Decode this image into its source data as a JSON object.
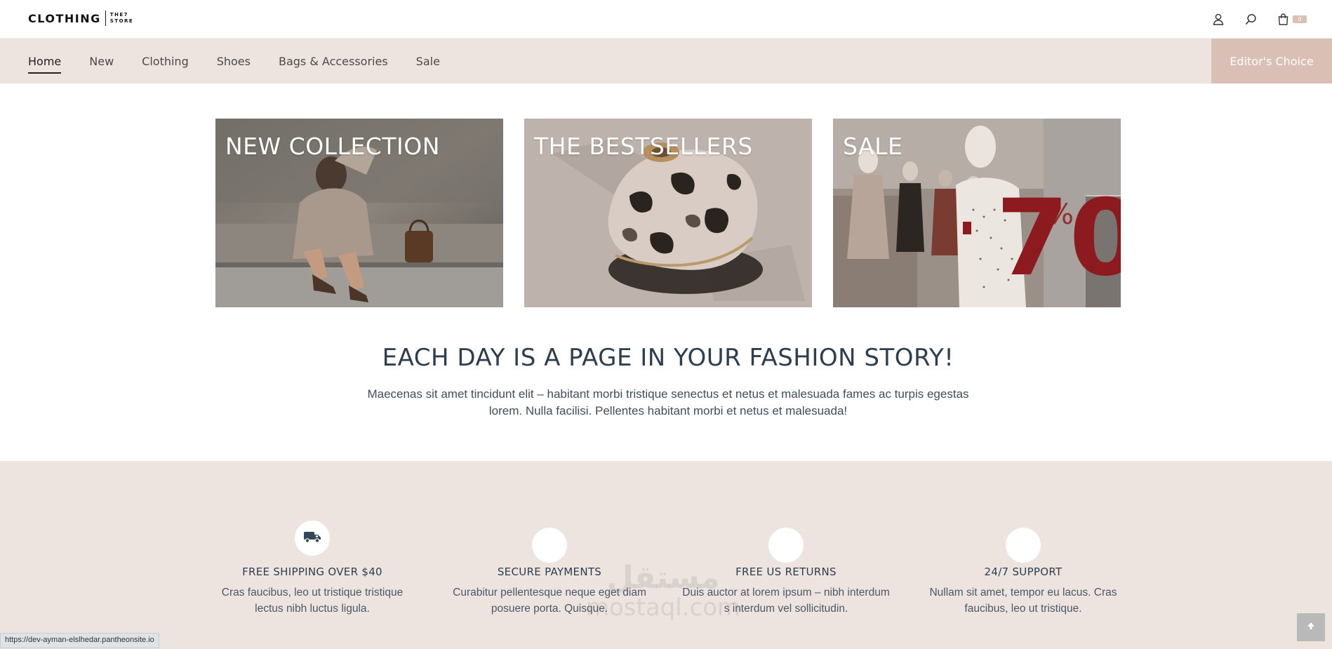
{
  "header": {
    "logo_main": "CLOTHING",
    "logo_small_1": "THE7",
    "logo_small_2": "STORE",
    "icons": [
      "user-icon",
      "search-icon",
      "cart-icon"
    ],
    "cart_count": "0"
  },
  "nav": {
    "items": [
      {
        "label": "Home",
        "active": true
      },
      {
        "label": "New"
      },
      {
        "label": "Clothing"
      },
      {
        "label": "Shoes"
      },
      {
        "label": "Bags & Accessories"
      },
      {
        "label": "Sale"
      }
    ],
    "cta": "Editor's Choice"
  },
  "banners": [
    {
      "title": "NEW COLLECTION"
    },
    {
      "title": "THE BESTSELLERS"
    },
    {
      "title": "SALE",
      "sign_number": "70",
      "sign_percent": "%"
    }
  ],
  "intro": {
    "headline": "EACH DAY IS A PAGE IN YOUR FASHION STORY!",
    "text": "Maecenas sit amet tincidunt elit – habitant morbi tristique senectus et netus et malesuada fames ac turpis egestas lorem. Nulla facilisi. Pellentes habitant morbi et netus et malesuada!"
  },
  "features": [
    {
      "icon": "truck-icon",
      "title": "FREE SHIPPING OVER $40",
      "text": "Cras faucibus, leo ut tristique tristique lectus nibh luctus ligula."
    },
    {
      "icon": "",
      "title": "SECURE PAYMENTS",
      "text": "Curabitur pellentesque neque eget diam posuere porta. Quisque."
    },
    {
      "icon": "",
      "title": "FREE US RETURNS",
      "text": "Duis auctor at lorem ipsum – nibh interdum s interdum vel sollicitudin."
    },
    {
      "icon": "",
      "title": "24/7 SUPPORT",
      "text": "Nullam sit amet, tempor eu lacus. Cras faucibus, leo ut tristique."
    }
  ],
  "watermark": {
    "arabic": "مستقل",
    "latin": "mostaql.com"
  },
  "status_url": "https://dev-ayman-elslhedar.pantheonsite.io",
  "colors": {
    "accent": "#d9bfb4",
    "nav_bg": "#ede4df",
    "heading": "#2d3e50"
  }
}
